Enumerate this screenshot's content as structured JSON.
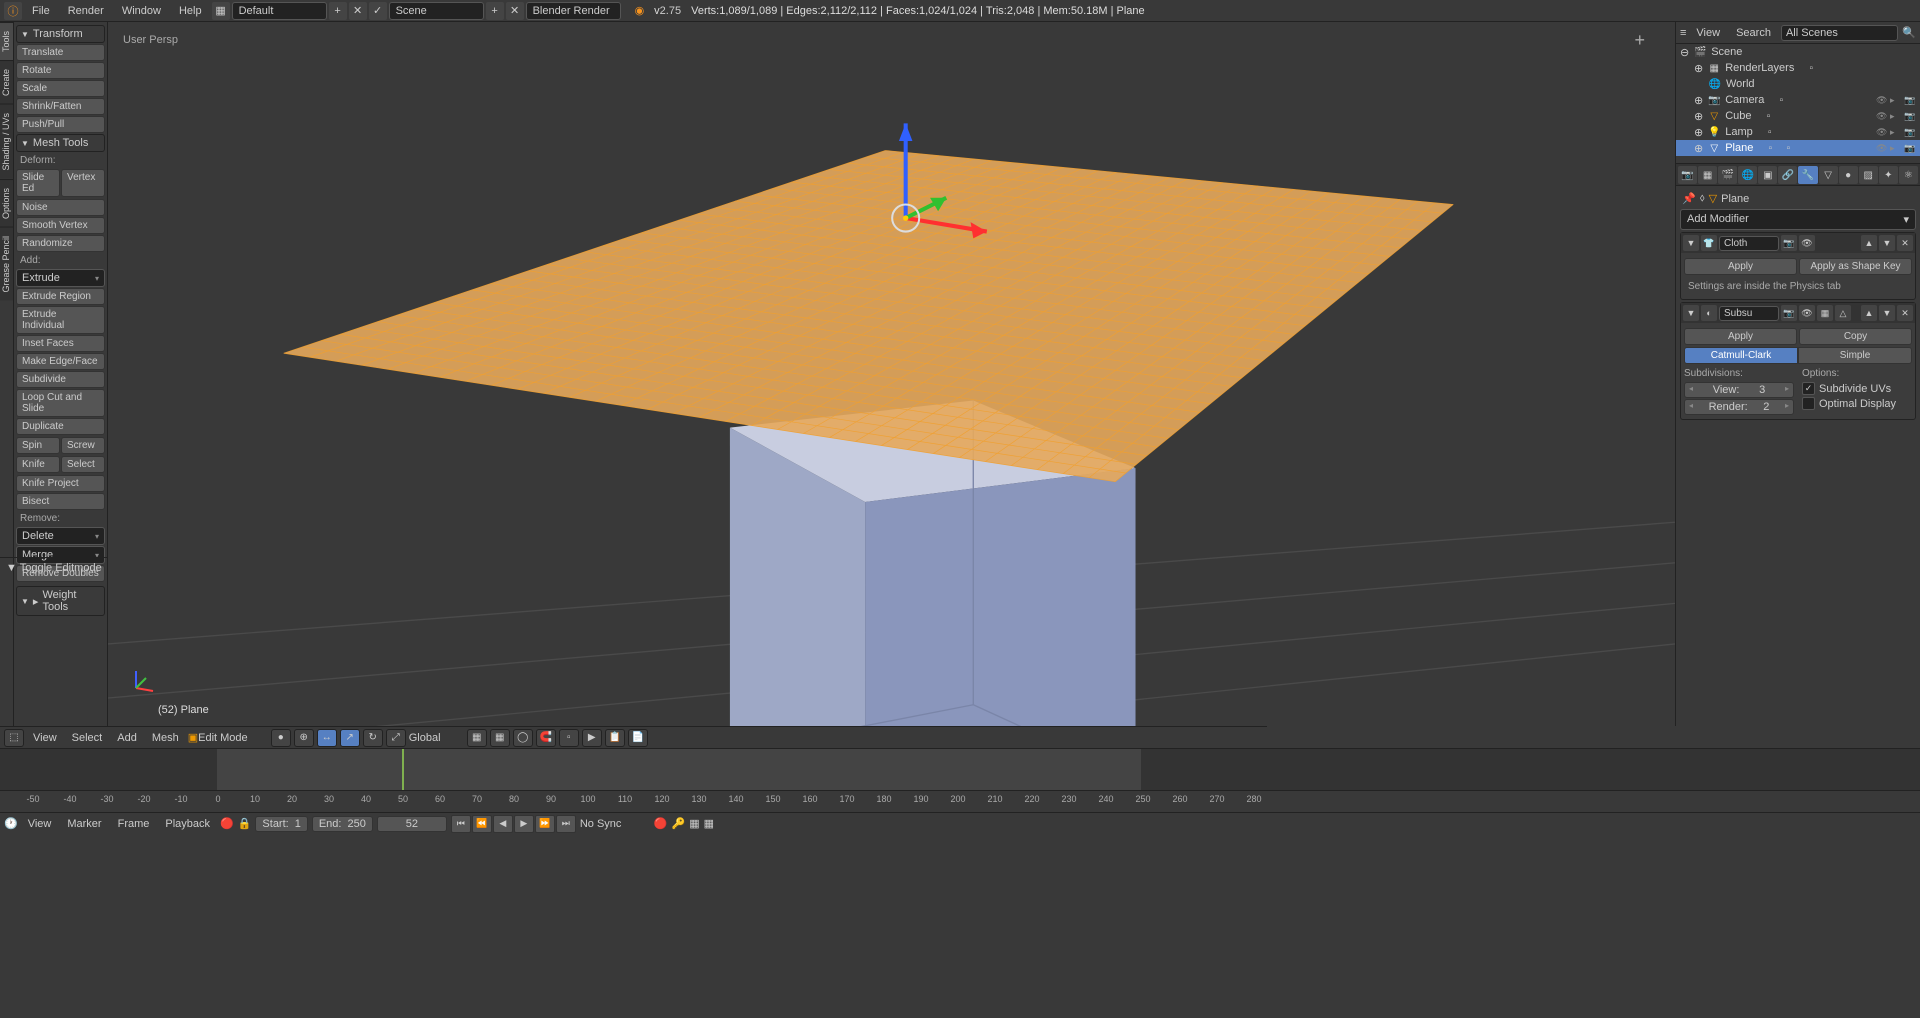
{
  "topbar": {
    "menus": [
      "File",
      "Render",
      "Window",
      "Help"
    ],
    "layout": "Default",
    "scene": "Scene",
    "engine": "Blender Render",
    "version": "2.75",
    "stats": "Verts:1,089/1,089 | Edges:2,112/2,112 | Faces:1,024/1,024 | Tris:2,048 | Mem:50.18M | Plane"
  },
  "left": {
    "vtabs": [
      "Tools",
      "Create",
      "Shading / UVs",
      "Options",
      "Grease Pencil"
    ],
    "transform_head": "Transform",
    "transform": [
      "Translate",
      "Rotate",
      "Scale",
      "Shrink/Fatten",
      "Push/Pull"
    ],
    "mesh_head": "Mesh Tools",
    "deform_label": "Deform:",
    "slide_edge": "Slide Ed",
    "vertex": "Vertex",
    "noise": "Noise",
    "smooth_vertex": "Smooth Vertex",
    "randomize": "Randomize",
    "add_label": "Add:",
    "extrude": "Extrude",
    "extrude_region": "Extrude Region",
    "extrude_individual": "Extrude Individual",
    "inset": "Inset Faces",
    "make_edge": "Make Edge/Face",
    "subdivide": "Subdivide",
    "loopcut": "Loop Cut and Slide",
    "duplicate": "Duplicate",
    "spin": "Spin",
    "screw": "Screw",
    "knife": "Knife",
    "select": "Select",
    "knife_project": "Knife Project",
    "bisect": "Bisect",
    "remove_label": "Remove:",
    "delete": "Delete",
    "merge": "Merge",
    "remove_doubles": "Remove Doubles",
    "weight_head": "Weight Tools",
    "editmode_head": "Toggle Editmode"
  },
  "viewport": {
    "persp": "User Persp",
    "object": "(52) Plane"
  },
  "vp_footer": {
    "menus": [
      "View",
      "Select",
      "Add",
      "Mesh"
    ],
    "mode": "Edit Mode",
    "orientation": "Global"
  },
  "right": {
    "menus": [
      "View",
      "Search"
    ],
    "scenes_dd": "All Scenes",
    "outliner": {
      "scene": "Scene",
      "renderlayers": "RenderLayers",
      "world": "World",
      "camera": "Camera",
      "cube": "Cube",
      "lamp": "Lamp",
      "plane": "Plane"
    },
    "breadcrumb": "Plane",
    "add_modifier": "Add Modifier",
    "mod1": {
      "name": "Cloth",
      "apply": "Apply",
      "apply_shape": "Apply as Shape Key",
      "note": "Settings are inside the Physics tab"
    },
    "mod2": {
      "name": "Subsu",
      "apply": "Apply",
      "copy": "Copy",
      "catmull": "Catmull-Clark",
      "simple": "Simple",
      "subdiv_label": "Subdivisions:",
      "view_label": "View:",
      "view_val": "3",
      "render_label": "Render:",
      "render_val": "2",
      "options_label": "Options:",
      "sub_uvs": "Subdivide UVs",
      "opt_display": "Optimal Display"
    }
  },
  "timeline": {
    "menus": [
      "View",
      "Marker",
      "Frame",
      "Playback"
    ],
    "start_label": "Start:",
    "start_val": "1",
    "end_label": "End:",
    "end_val": "250",
    "current": "52",
    "sync": "No Sync",
    "ticks": [
      "-50",
      "-40",
      "-30",
      "-20",
      "-10",
      "0",
      "10",
      "20",
      "30",
      "40",
      "50",
      "60",
      "70",
      "80",
      "90",
      "100",
      "110",
      "120",
      "130",
      "140",
      "150",
      "160",
      "170",
      "180",
      "190",
      "200",
      "210",
      "220",
      "230",
      "240",
      "250",
      "260",
      "270",
      "280"
    ]
  }
}
